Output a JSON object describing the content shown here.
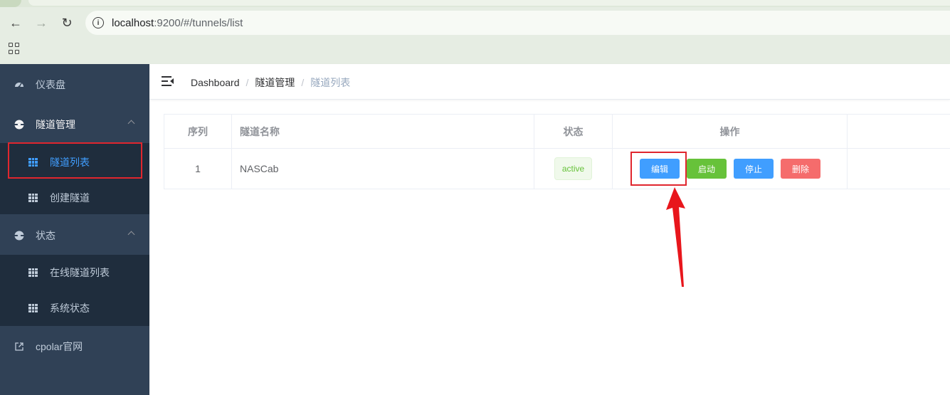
{
  "browser": {
    "url_host": "localhost",
    "url_rest": ":9200/#/tunnels/list"
  },
  "sidebar": {
    "items": [
      {
        "label": "仪表盘",
        "icon": "dashboard-icon"
      },
      {
        "label": "隧道管理",
        "icon": "circle-dot-icon",
        "children": [
          {
            "label": "隧道列表",
            "active": true,
            "icon": "table-grid-icon"
          },
          {
            "label": "创建隧道",
            "icon": "table-grid-icon"
          }
        ]
      },
      {
        "label": "状态",
        "icon": "circle-dot-icon",
        "children": [
          {
            "label": "在线隧道列表",
            "icon": "table-grid-icon"
          },
          {
            "label": "系统状态",
            "icon": "table-grid-icon"
          }
        ]
      },
      {
        "label": "cpolar官网",
        "icon": "external-link-icon"
      }
    ]
  },
  "breadcrumb": {
    "home": "Dashboard",
    "parent": "隧道管理",
    "current": "隧道列表"
  },
  "table": {
    "headers": [
      "序列",
      "隧道名称",
      "状态",
      "操作"
    ],
    "rows": [
      {
        "index": "1",
        "name": "NASCab",
        "status": "active"
      }
    ],
    "actions": [
      "编辑",
      "启动",
      "停止",
      "删除"
    ]
  },
  "colors": {
    "sidebar_bg": "#304156",
    "submenu_bg": "#1f2d3d",
    "active": "#409eff",
    "annotation": "#e0262e"
  }
}
